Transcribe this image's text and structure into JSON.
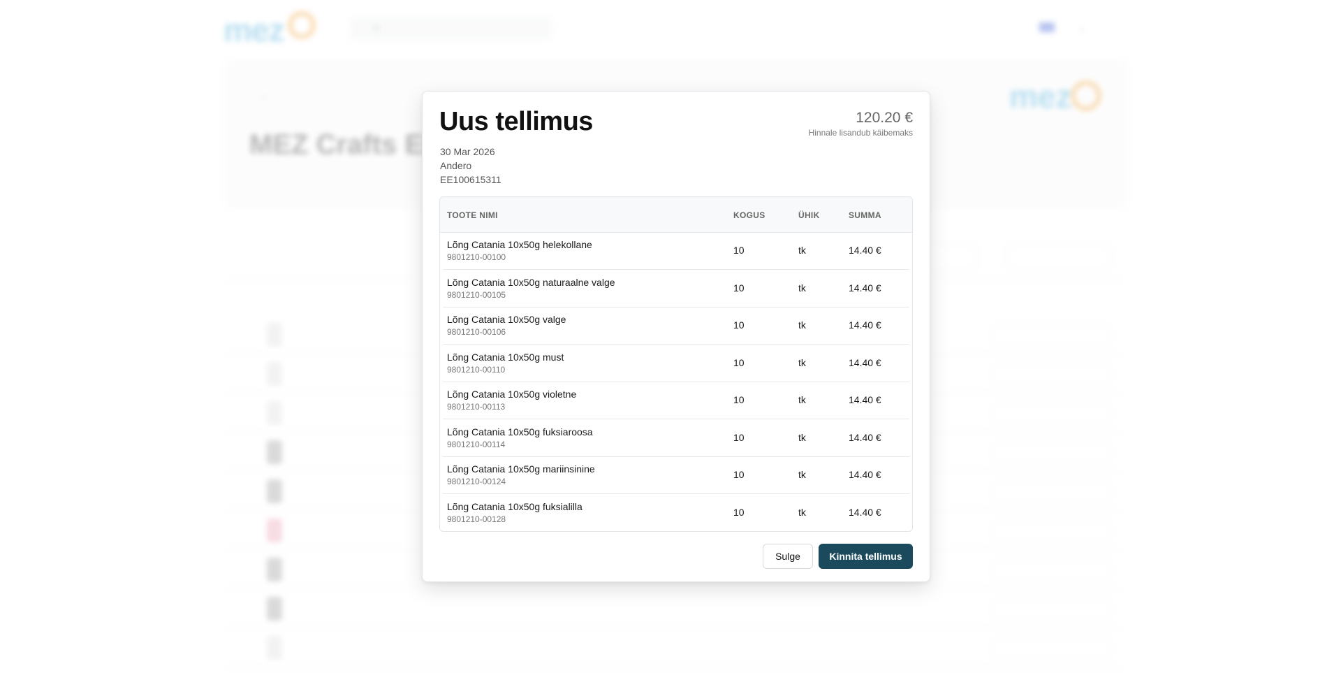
{
  "modal": {
    "title": "Uus tellimus",
    "date": "30 Mar 2026",
    "customer": "Andero",
    "reg_code": "EE100615311",
    "total": "120.20 €",
    "vat_note": "Hinnale lisandub käibemaks",
    "columns": {
      "name": "TOOTE NIMI",
      "qty": "KOGUS",
      "unit": "ÜHIK",
      "sum": "SUMMA"
    },
    "items": [
      {
        "name": "Lõng Catania 10x50g helekollane",
        "code": "9801210-00100",
        "qty": "10",
        "unit": "tk",
        "sum": "14.40 €"
      },
      {
        "name": "Lõng Catania 10x50g naturaalne valge",
        "code": "9801210-00105",
        "qty": "10",
        "unit": "tk",
        "sum": "14.40 €"
      },
      {
        "name": "Lõng Catania 10x50g valge",
        "code": "9801210-00106",
        "qty": "10",
        "unit": "tk",
        "sum": "14.40 €"
      },
      {
        "name": "Lõng Catania 10x50g must",
        "code": "9801210-00110",
        "qty": "10",
        "unit": "tk",
        "sum": "14.40 €"
      },
      {
        "name": "Lõng Catania 10x50g violetne",
        "code": "9801210-00113",
        "qty": "10",
        "unit": "tk",
        "sum": "14.40 €"
      },
      {
        "name": "Lõng Catania 10x50g fuksiaroosa",
        "code": "9801210-00114",
        "qty": "10",
        "unit": "tk",
        "sum": "14.40 €"
      },
      {
        "name": "Lõng Catania 10x50g mariinsinine",
        "code": "9801210-00124",
        "qty": "10",
        "unit": "tk",
        "sum": "14.40 €"
      },
      {
        "name": "Lõng Catania 10x50g fuksialilla",
        "code": "9801210-00128",
        "qty": "10",
        "unit": "tk",
        "sum": "14.40 €"
      }
    ],
    "close_label": "Sulge",
    "confirm_label": "Kinnita tellimus"
  },
  "background": {
    "logo": "mez",
    "title": "MEZ Crafts Esto"
  },
  "colors": {
    "primary": "#1b4a5c",
    "logo_blue": "#3aa6d8",
    "logo_orange": "#f2a23a"
  }
}
